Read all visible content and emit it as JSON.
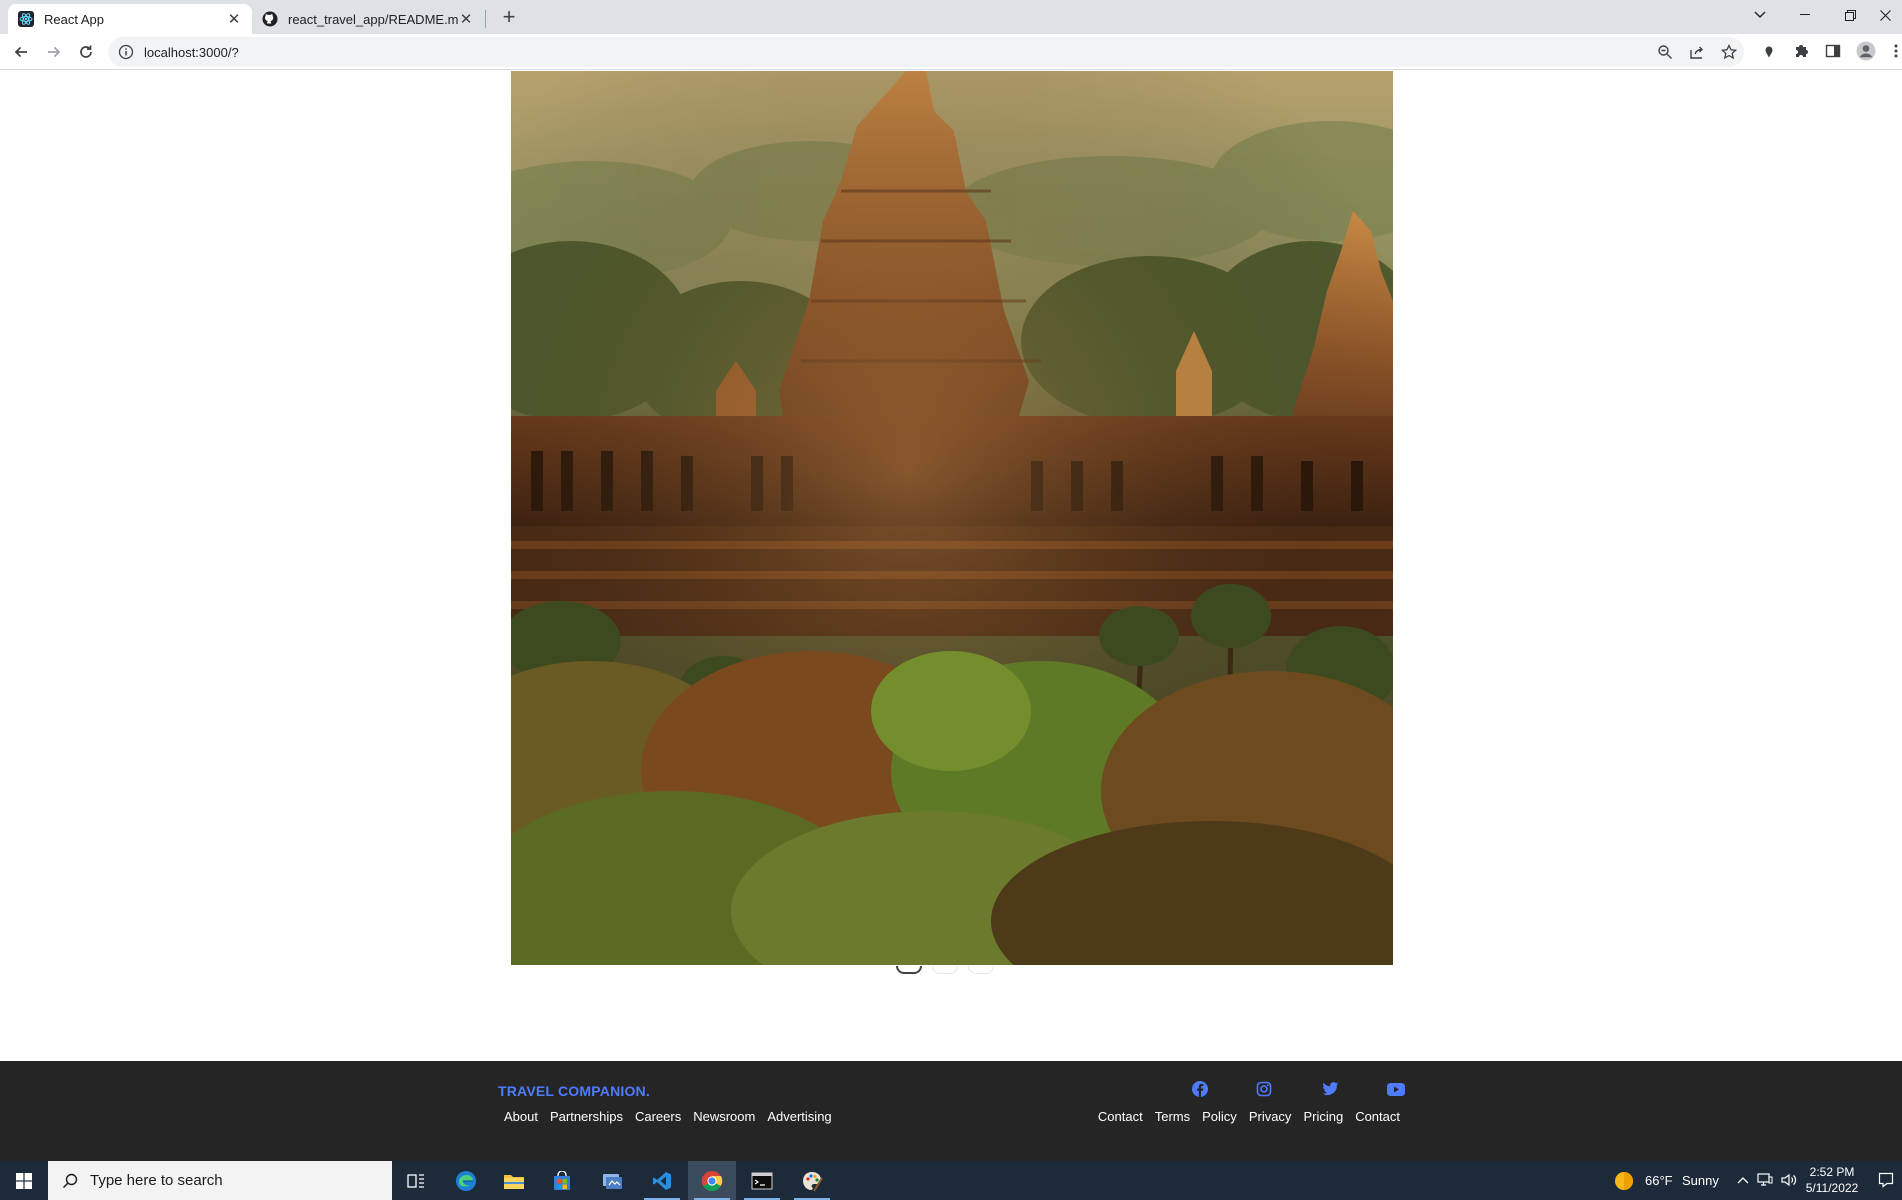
{
  "browser": {
    "tabs": [
      {
        "title": "React App",
        "icon": "react-favicon",
        "active": true
      },
      {
        "title": "react_travel_app/README.md at",
        "icon": "github-favicon",
        "active": false
      }
    ],
    "url": "localhost:3000/?",
    "new_tab_icon": "plus-icon"
  },
  "page": {
    "hero": {
      "subject": "temple-landscape-photo"
    },
    "carousel": {
      "slides": 3,
      "active_index": 0
    },
    "footer": {
      "brand": "TRAVEL COMPANION.",
      "left_links": [
        "About",
        "Partnerships",
        "Careers",
        "Newsroom",
        "Advertising"
      ],
      "right_links": [
        "Contact",
        "Terms",
        "Policy",
        "Privacy",
        "Pricing",
        "Contact"
      ],
      "socials": [
        "facebook-icon",
        "instagram-icon",
        "twitter-icon",
        "youtube-icon"
      ],
      "accent_color": "#4f7cff",
      "background_color": "#252525"
    }
  },
  "taskbar": {
    "search_placeholder": "Type here to search",
    "apps": [
      "task-view-icon",
      "edge-icon",
      "file-explorer-icon",
      "store-icon",
      "app-icon",
      "vscode-icon",
      "chrome-icon",
      "terminal-icon",
      "paint-icon"
    ],
    "weather": {
      "temp": "66°F",
      "condition": "Sunny"
    },
    "clock": {
      "time": "2:52 PM",
      "date": "5/11/2022"
    }
  }
}
